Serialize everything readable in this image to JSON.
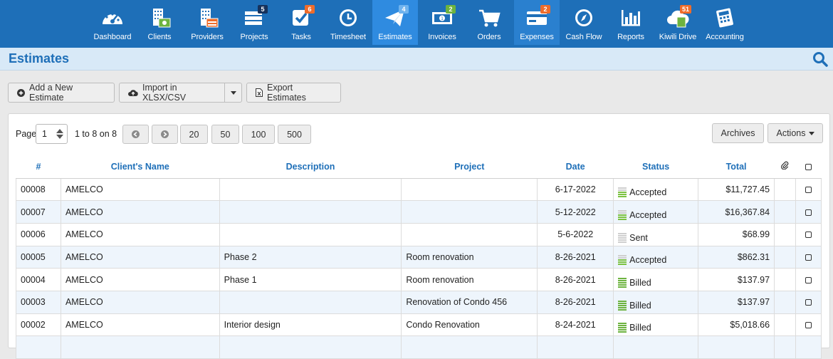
{
  "nav": [
    {
      "key": "dashboard",
      "label": "Dashboard",
      "icon": "dashboard-gauge-icon",
      "badge": ""
    },
    {
      "key": "clients",
      "label": "Clients",
      "icon": "clients-building-icon",
      "badge": ""
    },
    {
      "key": "providers",
      "label": "Providers",
      "icon": "providers-building-icon",
      "badge": ""
    },
    {
      "key": "projects",
      "label": "Projects",
      "icon": "projects-stack-icon",
      "badge": "5"
    },
    {
      "key": "tasks",
      "label": "Tasks",
      "icon": "tasks-check-icon",
      "badge": "6"
    },
    {
      "key": "timesheet",
      "label": "Timesheet",
      "icon": "timesheet-clock-icon",
      "badge": ""
    },
    {
      "key": "estimates",
      "label": "Estimates",
      "icon": "estimates-paper-plane-icon",
      "badge": "4"
    },
    {
      "key": "invoices",
      "label": "Invoices",
      "icon": "invoices-money-icon",
      "badge": "2"
    },
    {
      "key": "orders",
      "label": "Orders",
      "icon": "orders-cart-icon",
      "badge": ""
    },
    {
      "key": "expenses",
      "label": "Expenses",
      "icon": "expenses-card-icon",
      "badge": "2"
    },
    {
      "key": "cashflow",
      "label": "Cash Flow",
      "icon": "cash-flow-compass-icon",
      "badge": ""
    },
    {
      "key": "reports",
      "label": "Reports",
      "icon": "reports-bar-chart-icon",
      "badge": ""
    },
    {
      "key": "drive",
      "label": "Kiwili Drive",
      "icon": "kiwili-drive-cloud-icon",
      "badge": "51"
    },
    {
      "key": "accounting",
      "label": "Accounting",
      "icon": "accounting-calculator-icon",
      "badge": ""
    }
  ],
  "page": {
    "title": "Estimates"
  },
  "toolbar": {
    "add_label": "Add a New Estimate",
    "import_label": "Import in XLSX/CSV",
    "export_label": "Export Estimates"
  },
  "pager": {
    "page_label": "Page",
    "page_value": "1",
    "range_text": "1 to 8 on 8",
    "sizes": [
      "20",
      "50",
      "100",
      "500"
    ],
    "archives_label": "Archives",
    "actions_label": "Actions"
  },
  "table": {
    "headers": {
      "num": "#",
      "client": "Client's Name",
      "description": "Description",
      "project": "Project",
      "date": "Date",
      "status": "Status",
      "total": "Total"
    },
    "rows": [
      {
        "num": "00008",
        "client": "AMELCO",
        "description": "",
        "project": "",
        "date": "6-17-2022",
        "status": "Accepted",
        "total": "$11,727.45"
      },
      {
        "num": "00007",
        "client": "AMELCO",
        "description": "",
        "project": "",
        "date": "5-12-2022",
        "status": "Accepted",
        "total": "$16,367.84"
      },
      {
        "num": "00006",
        "client": "AMELCO",
        "description": "",
        "project": "",
        "date": "5-6-2022",
        "status": "Sent",
        "total": "$68.99"
      },
      {
        "num": "00005",
        "client": "AMELCO",
        "description": "Phase 2",
        "project": "Room renovation",
        "date": "8-26-2021",
        "status": "Accepted",
        "total": "$862.31"
      },
      {
        "num": "00004",
        "client": "AMELCO",
        "description": "Phase 1",
        "project": "Room renovation",
        "date": "8-26-2021",
        "status": "Billed",
        "total": "$137.97"
      },
      {
        "num": "00003",
        "client": "AMELCO",
        "description": "",
        "project": "Renovation of Condo 456",
        "date": "8-26-2021",
        "status": "Billed",
        "total": "$137.97"
      },
      {
        "num": "00002",
        "client": "AMELCO",
        "description": "Interior design",
        "project": "Condo Renovation",
        "date": "8-24-2021",
        "status": "Billed",
        "total": "$5,018.66"
      }
    ]
  },
  "colors": {
    "nav_bg": "#1e6fb8",
    "nav_active": "#2f8be0",
    "title_bar": "#d8e9f7",
    "accent": "#1e6fb8",
    "billed_green": "#6db33f"
  }
}
